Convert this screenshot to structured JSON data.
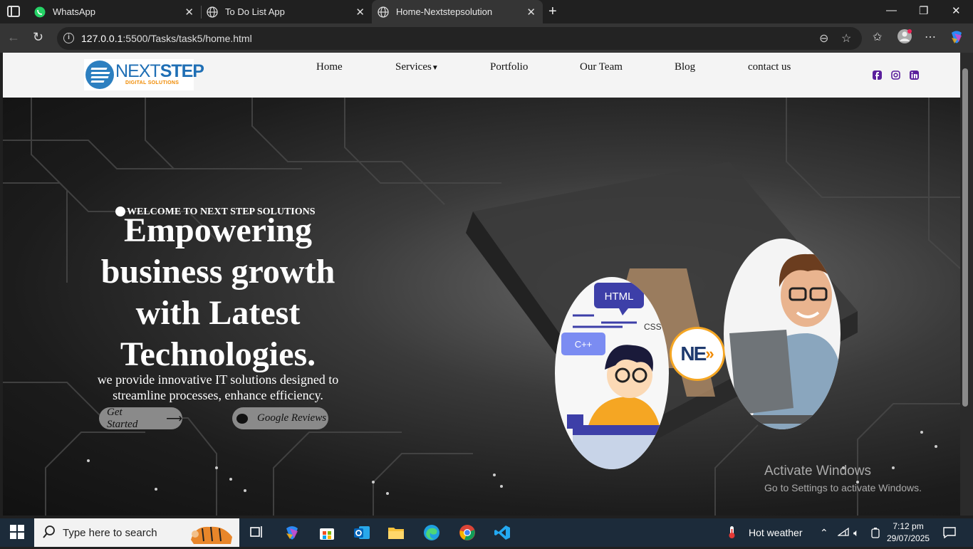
{
  "browser": {
    "tabs": [
      {
        "title": "WhatsApp",
        "icon": "whatsapp-icon"
      },
      {
        "title": "To Do List App",
        "icon": "globe-icon"
      },
      {
        "title": "Home-Nextstepsolution",
        "icon": "globe-icon",
        "active": true
      }
    ],
    "url_host": "127.0.0.1",
    "url_rest": ":5500/Tasks/task5/home.html"
  },
  "site": {
    "logo": {
      "main_n": "N",
      "main_ext": "EXT",
      "main_step": "STEP",
      "sub": "DIGITAL SOLUTIONS"
    },
    "nav": [
      "Home",
      "Services",
      "Portfolio",
      "Our Team",
      "Blog",
      "contact us"
    ],
    "social": [
      "facebook-icon",
      "instagram-icon",
      "linkedin-icon"
    ],
    "hero": {
      "welcome": "WELCOME TO NEXT STEP SOLUTIONS",
      "headline": "Empowering business growth with Latest Technologies.",
      "subtext": "we provide innovative IT solutions designed to streamline processes, enhance efficiency.",
      "btn_primary": "Get Started",
      "btn_secondary": "Google Reviews",
      "html_label": "HTML",
      "css_label": "CSS",
      "cpp_label": "C++",
      "badge": "NE"
    }
  },
  "watermark": {
    "line1": "Activate Windows",
    "line2": "Go to Settings to activate Windows."
  },
  "taskbar": {
    "search_placeholder": "Type here to search",
    "weather": "Hot weather",
    "time": "7:12 pm",
    "date": "29/07/2025"
  }
}
